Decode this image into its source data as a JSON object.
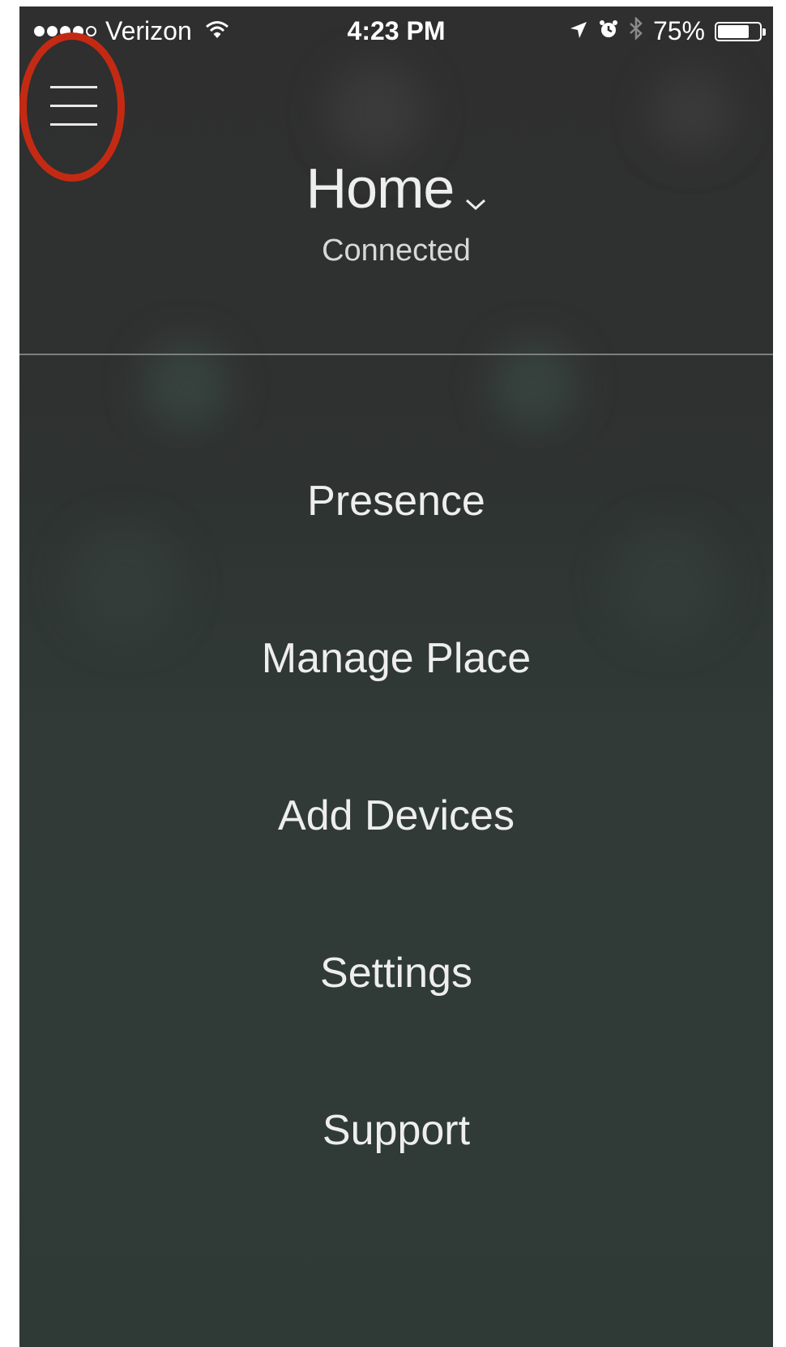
{
  "status_bar": {
    "carrier": "Verizon",
    "time": "4:23 PM",
    "battery": "75%",
    "battery_level": 0.75
  },
  "header": {
    "place_title": "Home",
    "connection_status": "Connected"
  },
  "menu": {
    "items": [
      {
        "label": "Presence"
      },
      {
        "label": "Manage Place"
      },
      {
        "label": "Add Devices"
      },
      {
        "label": "Settings"
      },
      {
        "label": "Support"
      }
    ]
  },
  "colors": {
    "annotation_ring": "#c42a13",
    "background": "#2f3a37",
    "text": "#eeeeee"
  },
  "icons": {
    "menu": "hamburger-icon",
    "dropdown": "chevron-down-icon",
    "wifi": "wifi-icon",
    "location": "location-arrow-icon",
    "alarm": "alarm-icon",
    "bluetooth": "bluetooth-icon",
    "battery": "battery-icon"
  }
}
